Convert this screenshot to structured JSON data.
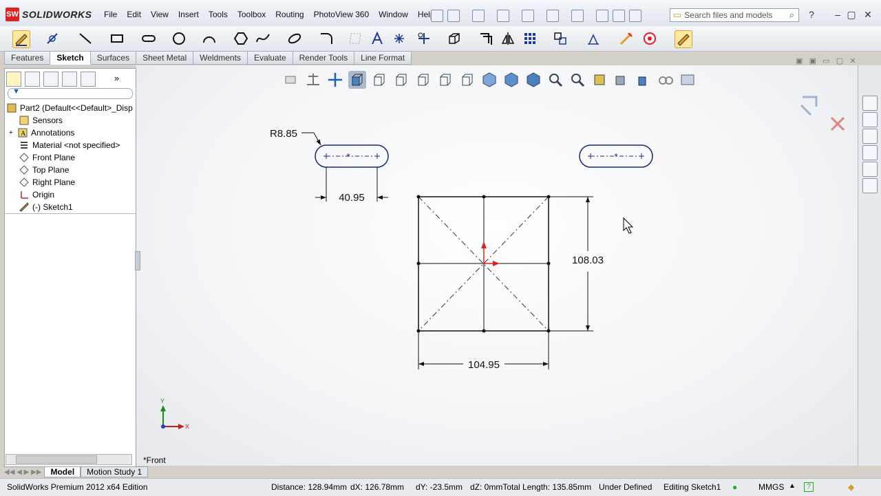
{
  "app": {
    "logo_text": "SOLIDWORKS"
  },
  "menu": [
    "File",
    "Edit",
    "View",
    "Insert",
    "Tools",
    "Toolbox",
    "Routing",
    "PhotoView 360",
    "Window",
    "Help"
  ],
  "search": {
    "placeholder": "Search files and models"
  },
  "tabs": [
    {
      "label": "Features"
    },
    {
      "label": "Sketch",
      "active": true
    },
    {
      "label": "Surfaces"
    },
    {
      "label": "Sheet Metal"
    },
    {
      "label": "Weldments"
    },
    {
      "label": "Evaluate"
    },
    {
      "label": "Render Tools"
    },
    {
      "label": "Line Format"
    }
  ],
  "tree": {
    "root": "Part2  (Default<<Default>_Disp",
    "items": [
      "Sensors",
      "Annotations",
      "Material <not specified>",
      "Front Plane",
      "Top Plane",
      "Right Plane",
      "Origin",
      "(-) Sketch1"
    ]
  },
  "sketch": {
    "radius_dim": "R8.85",
    "slot_width_dim": "40.95",
    "rect_height_dim": "108.03",
    "rect_width_dim": "104.95",
    "axis_x": "X",
    "axis_y": "Y"
  },
  "view_name": "*Front",
  "bottom_tabs": [
    {
      "label": "Model",
      "active": true
    },
    {
      "label": "Motion Study 1"
    }
  ],
  "status": {
    "edition": "SolidWorks Premium 2012 x64 Edition",
    "distance": "Distance: 128.94mm",
    "dx": "dX: 126.78mm",
    "dy": "dY: -23.5mm",
    "dz_total": "dZ: 0mmTotal Length: 135.85mm",
    "state": "Under Defined",
    "editing": "Editing Sketch1",
    "units": "MMGS"
  },
  "colors": {
    "accent": "#d22222",
    "sketch_line": "#1a237e",
    "dimension": "#111111",
    "origin_red": "#e02020"
  }
}
